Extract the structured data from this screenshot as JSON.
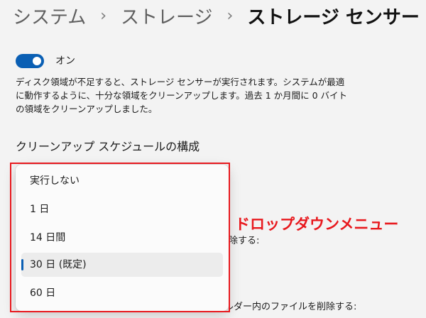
{
  "breadcrumb": {
    "items": [
      "システム",
      "ストレージ"
    ],
    "current": "ストレージ センサー",
    "separator": "›"
  },
  "toggle": {
    "state": "on",
    "label": "オン",
    "accent": "#0a5fb4"
  },
  "description": "ディスク領域が不足すると、ストレージ センサーが実行されます。システムが最適に動作するように、十分な領域をクリーンアップします。過去 1 か月間に 0 バイト の領域をクリーンアップしました。",
  "section_title": "クリーンアップ スケジュールの構成",
  "background_labels": [
    "除する:",
    "ルダー内のファイルを削除する:"
  ],
  "dropdown": {
    "options": [
      "実行しない",
      "1 日",
      "14 日間",
      "30 日 (既定)",
      "60 日"
    ],
    "selected_index": 3
  },
  "annotation": {
    "text": "ドロップダウンメニュー",
    "color": "#e8191e"
  }
}
